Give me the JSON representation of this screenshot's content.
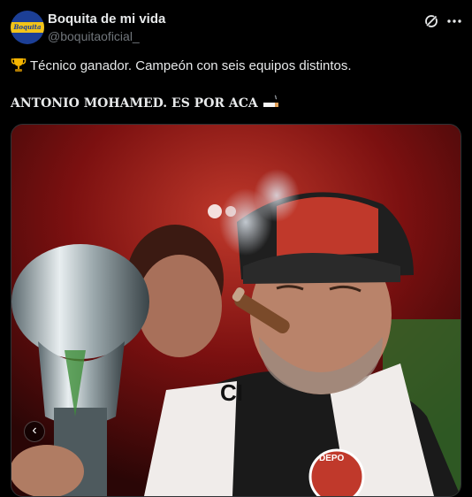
{
  "author": {
    "display_name": "Boquita de mi vida",
    "handle": "@boquitaoficial_",
    "avatar_text": "Boquita"
  },
  "post": {
    "line1": "Técnico ganador. Campeón con seis equipos distintos.",
    "line2": "ANTONIO MOHAMED. ES POR ACA"
  },
  "icons": {
    "trophy": "trophy-icon",
    "cigarette": "cigarette-icon",
    "grok": "grok-icon",
    "more": "more-icon",
    "carousel_prev": "chevron-left-icon"
  },
  "media": {
    "carousel_prev_glyph": "‹",
    "scarf_text": "CI",
    "badge_text": "DEPO"
  },
  "colors": {
    "background": "#000000",
    "text": "#e7e9ea",
    "secondary_text": "#71767b",
    "brand_blue": "#1c3f96",
    "brand_gold": "#f2c318"
  }
}
